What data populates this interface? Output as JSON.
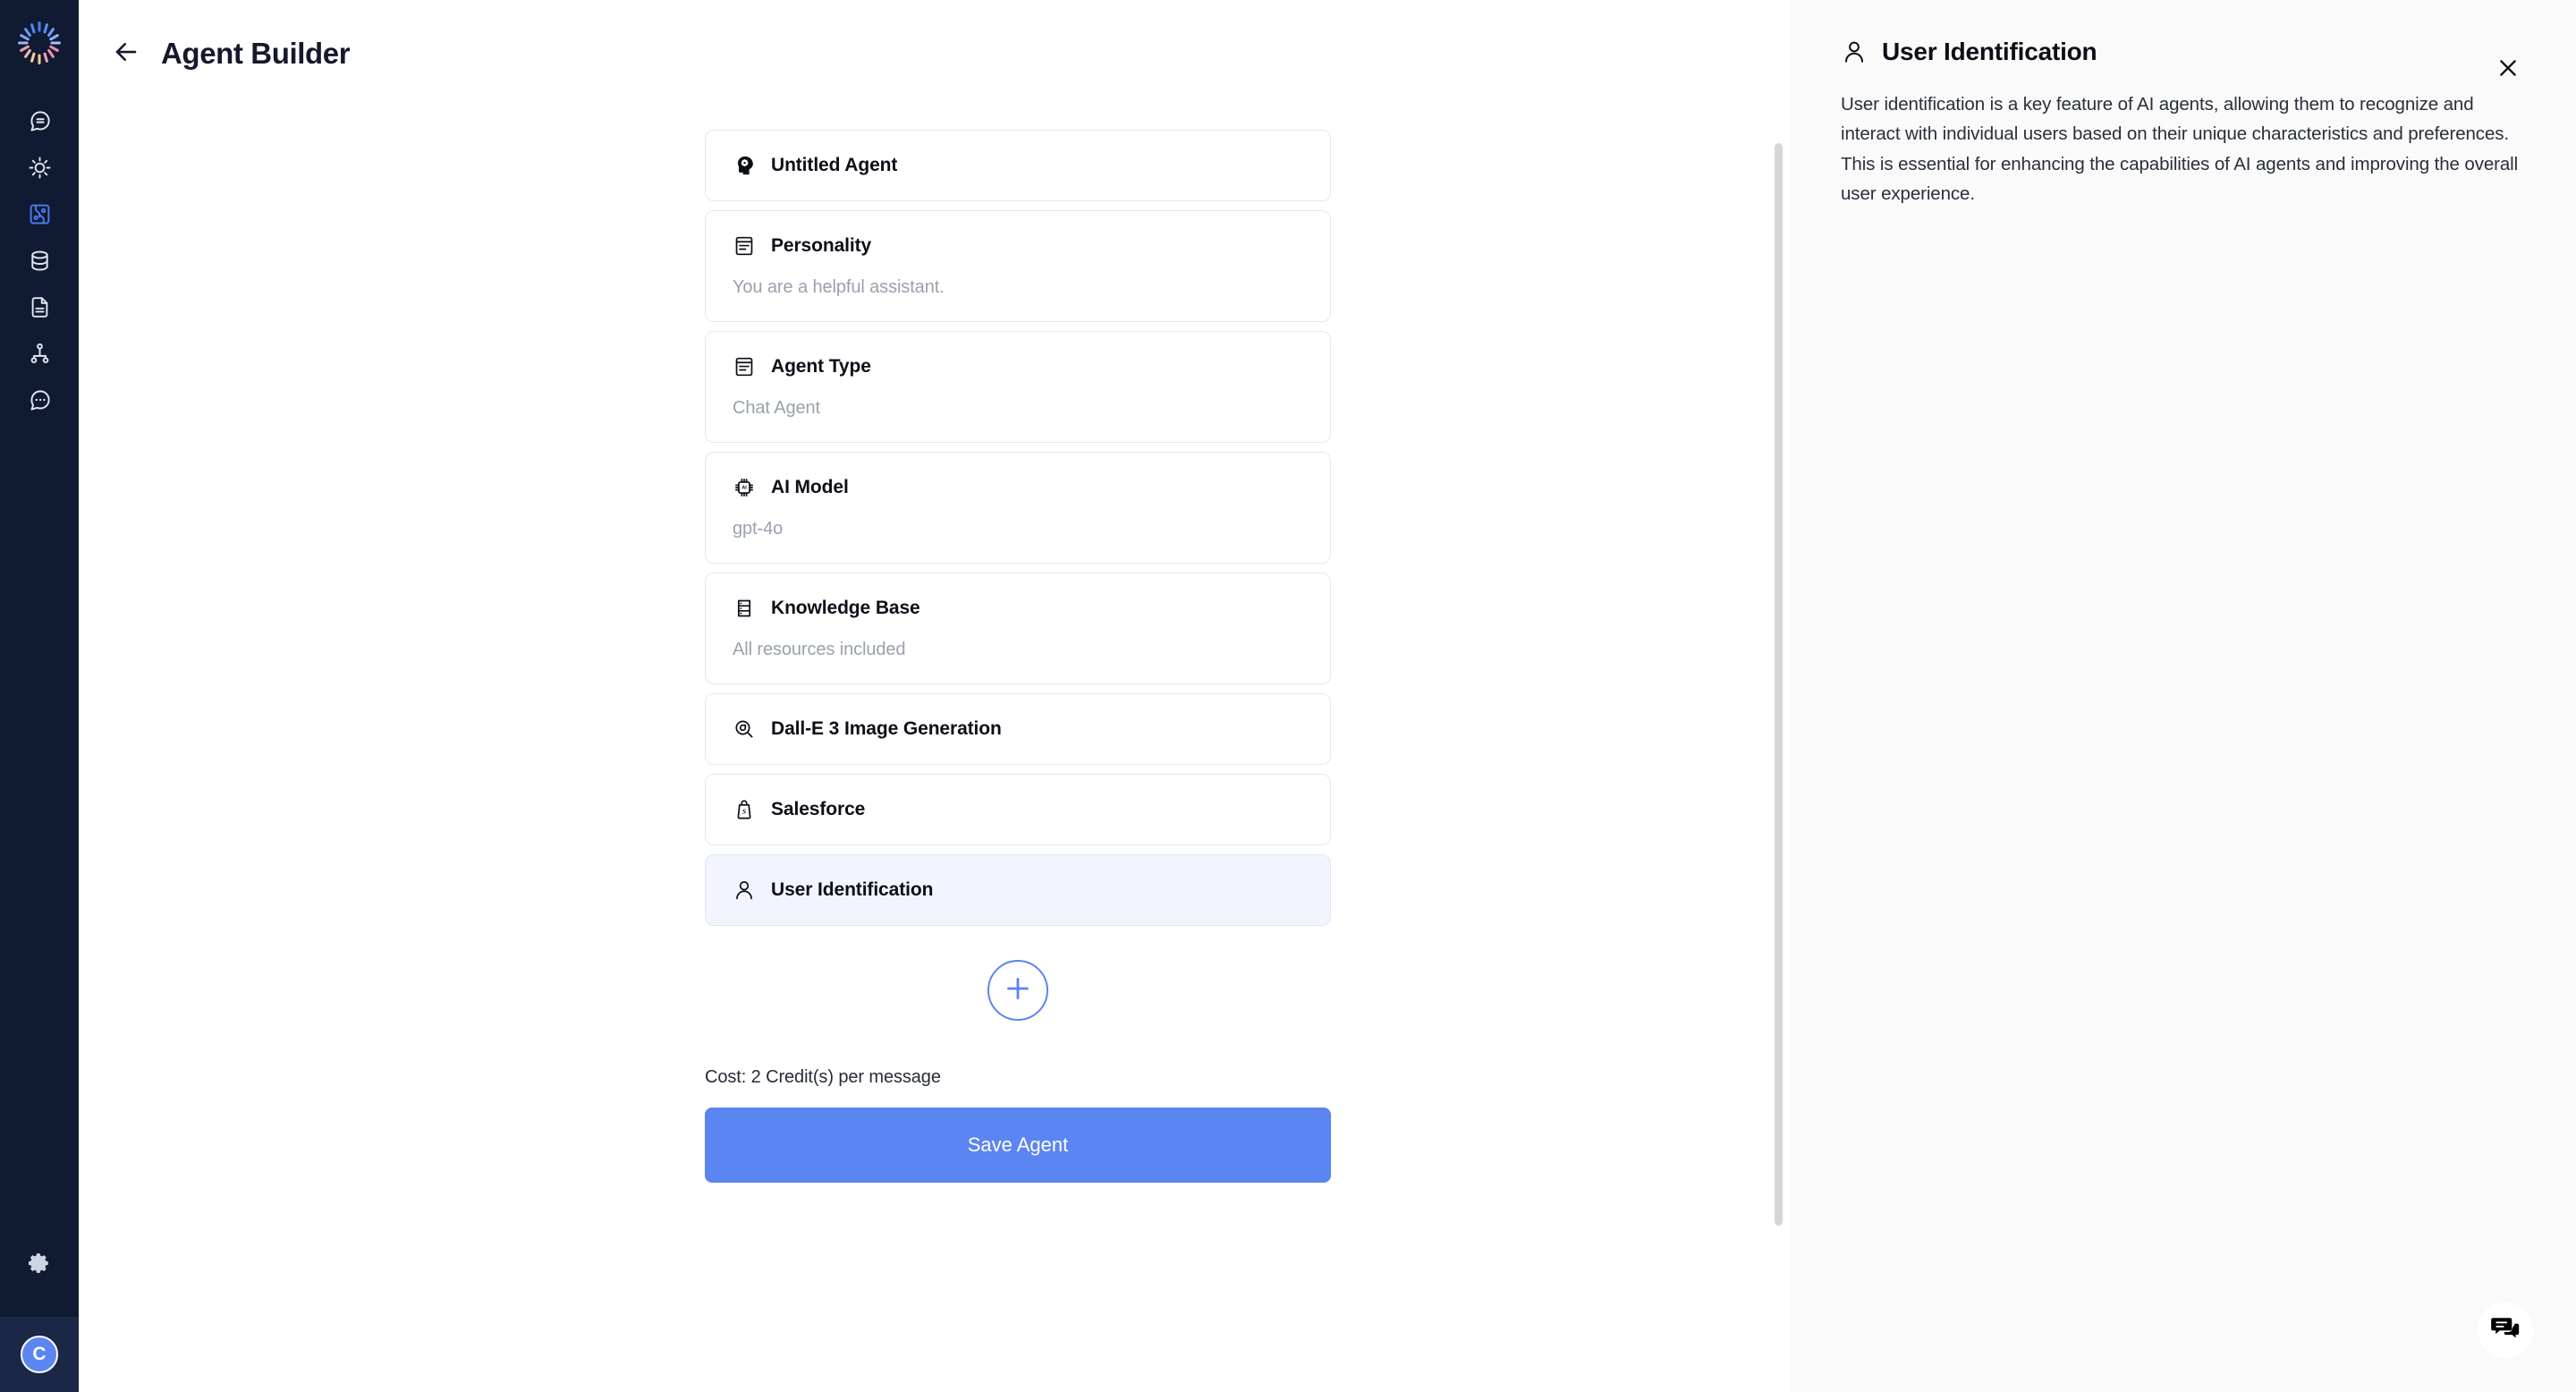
{
  "sidebar": {
    "logo_name": "brand-burst-logo",
    "items": [
      {
        "icon": "chat-bubble-equals-icon",
        "name": "sidebar-item-chat",
        "active": false
      },
      {
        "icon": "sun-gear-icon",
        "name": "sidebar-item-automations",
        "active": false
      },
      {
        "icon": "circuit-node-icon",
        "name": "sidebar-item-agent-builder",
        "active": true
      },
      {
        "icon": "database-icon",
        "name": "sidebar-item-knowledge",
        "active": false
      },
      {
        "icon": "document-icon",
        "name": "sidebar-item-documents",
        "active": false
      },
      {
        "icon": "org-tree-icon",
        "name": "sidebar-item-workflows",
        "active": false
      },
      {
        "icon": "chat-dots-icon",
        "name": "sidebar-item-conversations",
        "active": false
      }
    ],
    "settings_icon": "gear-icon",
    "avatar_initial": "C"
  },
  "header": {
    "back_icon": "arrow-left-icon",
    "title": "Agent Builder"
  },
  "builder": {
    "cards": [
      {
        "icon": "head-gear-icon",
        "title": "Untitled Agent",
        "subtitle": "",
        "selected": false
      },
      {
        "icon": "text-block-icon",
        "title": "Personality",
        "subtitle": "You are a helpful assistant.",
        "selected": false
      },
      {
        "icon": "text-block-icon",
        "title": "Agent Type",
        "subtitle": "Chat Agent",
        "selected": false
      },
      {
        "icon": "ai-chip-icon",
        "title": "AI Model",
        "subtitle": "gpt-4o",
        "selected": false
      },
      {
        "icon": "database-icon",
        "title": "Knowledge Base",
        "subtitle": "All resources included",
        "selected": false
      },
      {
        "icon": "image-search-icon",
        "title": "Dall-E 3 Image Generation",
        "subtitle": "",
        "selected": false
      },
      {
        "icon": "bag-icon",
        "title": "Salesforce",
        "subtitle": "",
        "selected": false
      },
      {
        "icon": "user-icon",
        "title": "User Identification",
        "subtitle": "",
        "selected": true
      }
    ],
    "add_button_icon": "plus-icon",
    "cost_text": "Cost: 2 Credit(s) per message",
    "save_label": "Save Agent"
  },
  "panel": {
    "icon": "user-icon",
    "title": "User Identification",
    "close_icon": "close-icon",
    "body": "User identification is a key feature of AI agents, allowing them to recognize and interact with individual users based on their unique characteristics and preferences. This is essential for enhancing the capabilities of AI agents and improving the overall user experience."
  },
  "widgets": {
    "chat_fab_icon": "chat-bubbles-icon"
  },
  "colors": {
    "rail_bg": "#101a33",
    "rail_footer_bg": "#1b2747",
    "accent": "#5b85f0",
    "active_nav": "#4a7df0",
    "card_border": "#e2e8f2",
    "card_selected_bg": "#f2f5fd",
    "panel_bg": "#fafafa",
    "muted_text": "#9aa1ae"
  }
}
